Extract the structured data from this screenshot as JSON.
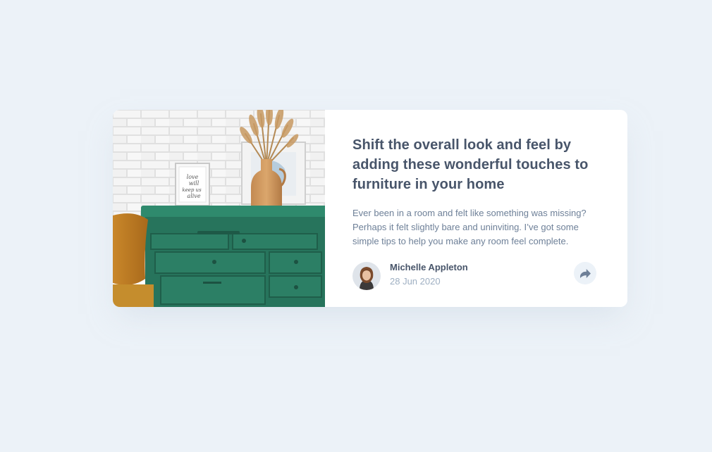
{
  "card": {
    "title": "Shift the overall look and feel by adding these wonderful touches to furniture in your home",
    "excerpt": "Ever been in a room and felt like something was missing? Perhaps it felt slightly bare and uninviting. I’ve got some simple tips to help you make any room feel complete.",
    "image": {
      "frame_text": "love will keep us alive"
    },
    "author": {
      "name": "Michelle Appleton",
      "date": "28 Jun 2020"
    },
    "share": {
      "icon": "share-icon"
    }
  },
  "colors": {
    "page_background": "#ecf2f8",
    "title": "#48556a",
    "body_text": "#6e8098",
    "muted_text": "#9eafc2",
    "dresser_green": "#2a7a62",
    "share_button_bg": "#ecf2f8"
  }
}
